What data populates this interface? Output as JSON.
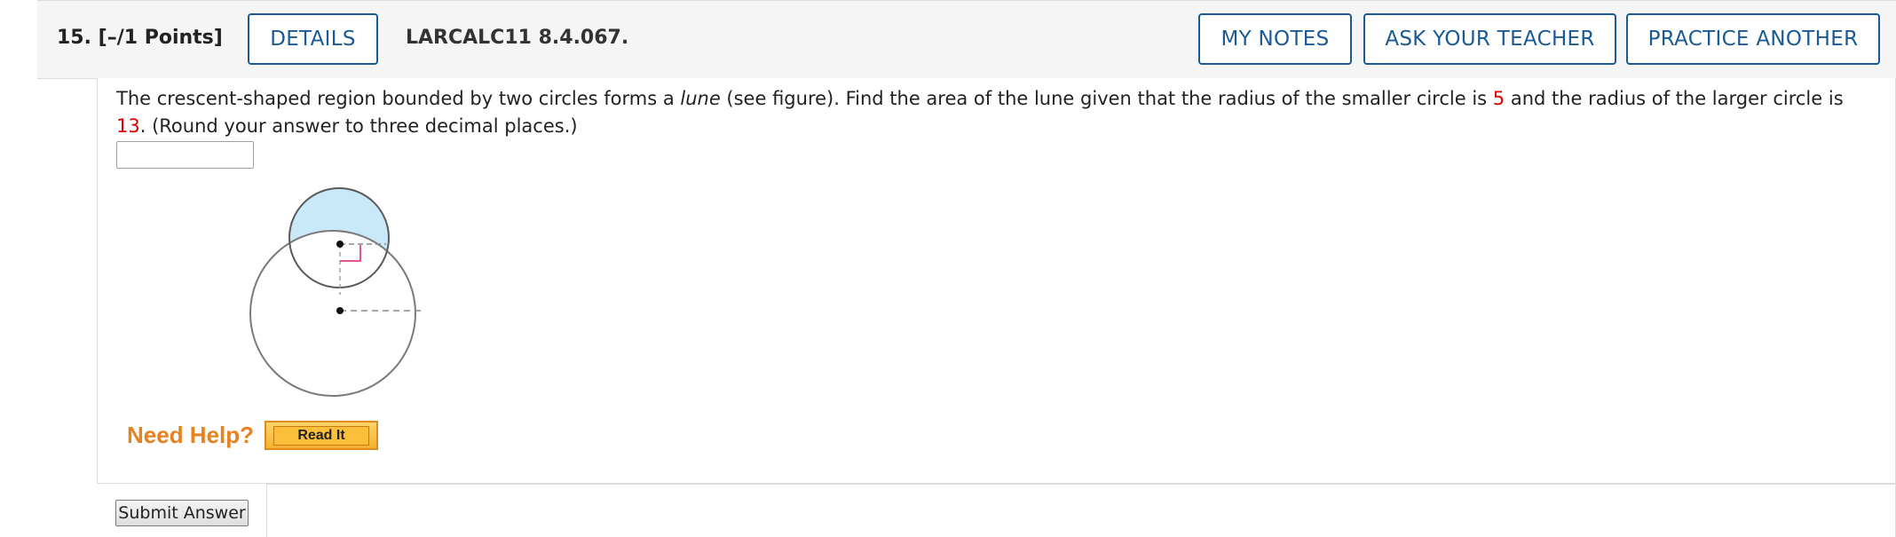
{
  "question": {
    "number": "15.",
    "points": "[–/1 Points]",
    "code": "LARCALC11 8.4.067."
  },
  "header_buttons": {
    "details": "DETAILS",
    "my_notes": "MY NOTES",
    "ask_teacher": "ASK YOUR TEACHER",
    "practice_another": "PRACTICE ANOTHER"
  },
  "prompt": {
    "part1": "The crescent-shaped region bounded by two circles forms a ",
    "lune_word": "lune",
    "part2": " (see figure). Find the area of the lune given that the radius of the smaller circle is ",
    "small_radius": "5",
    "part3": " and the radius of the larger circle is ",
    "large_radius": "13",
    "part4": ". (Round your answer to three decimal places.)"
  },
  "answer": {
    "value": ""
  },
  "help": {
    "label": "Need Help?",
    "read_it": "Read It"
  },
  "submit": {
    "label": "Submit Answer"
  },
  "colors": {
    "accent_blue": "#1a5a96",
    "highlight_red": "#e00000",
    "help_orange": "#e8821e",
    "lune_fill": "#c9e8f8",
    "right_angle_marker": "#e0559a"
  },
  "figure": {
    "icons": [
      "small-circle",
      "large-circle",
      "lune-region",
      "right-angle-marker",
      "center-dot"
    ]
  }
}
